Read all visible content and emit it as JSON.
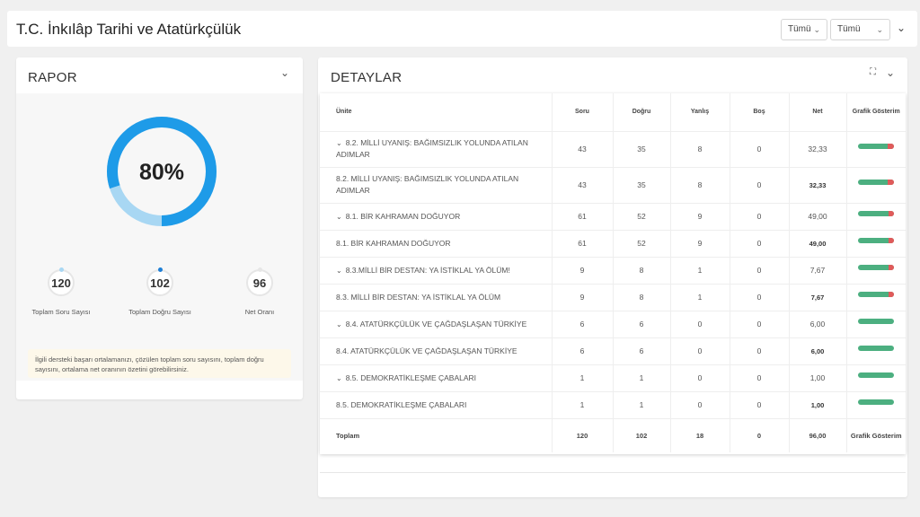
{
  "page_title": "T.C. İnkılâp Tarihi ve Atatürkçülük",
  "filters": [
    {
      "label": "Tümü"
    },
    {
      "label": "Tümü"
    }
  ],
  "colors": {
    "accent": "#1e9be8",
    "accent_light": "#a8d7f3",
    "bar_green": "#4caf80",
    "bar_red": "#e05a5a"
  },
  "rapor": {
    "title": "RAPOR",
    "percent": 80,
    "percent_label": "80%",
    "stats": [
      {
        "value": "120",
        "label": "Toplam Soru Sayısı",
        "dot_color": "#a8d7f3"
      },
      {
        "value": "102",
        "label": "Toplam Doğru Sayısı",
        "dot_color": "#1e7fd6"
      },
      {
        "value": "96",
        "label": "Net Oranı",
        "dot_color": "#e6e6e6"
      }
    ],
    "info": "İlgili dersteki başarı ortalamanızı, çözülen toplam soru sayısını, toplam doğru sayısını, ortalama net oranının özetini görebilirsiniz."
  },
  "detaylar": {
    "title": "DETAYLAR",
    "columns": [
      "Ünite",
      "Soru",
      "Doğru",
      "Yanlış",
      "Boş",
      "Net",
      "Grafik Gösterim"
    ],
    "rows": [
      {
        "unite": "8.2. MİLLİ UYANIŞ: BAĞIMSIZLIK YOLUNDA ATILAN ADIMLAR",
        "group": true,
        "tall": true,
        "soru": "43",
        "dogru": "35",
        "yanlis": "8",
        "bos": "0",
        "net": "32,33",
        "net_bold": false
      },
      {
        "unite": "8.2. MİLLİ UYANIŞ: BAĞIMSIZLIK YOLUNDA ATILAN ADIMLAR",
        "group": false,
        "tall": true,
        "soru": "43",
        "dogru": "35",
        "yanlis": "8",
        "bos": "0",
        "net": "32,33",
        "net_bold": true
      },
      {
        "unite": "8.1. BİR KAHRAMAN DOĞUYOR",
        "group": true,
        "tall": false,
        "soru": "61",
        "dogru": "52",
        "yanlis": "9",
        "bos": "0",
        "net": "49,00",
        "net_bold": false
      },
      {
        "unite": "8.1. BİR KAHRAMAN DOĞUYOR",
        "group": false,
        "tall": false,
        "soru": "61",
        "dogru": "52",
        "yanlis": "9",
        "bos": "0",
        "net": "49,00",
        "net_bold": true
      },
      {
        "unite": "8.3.MİLLİ BİR DESTAN: YA İSTİKLAL YA ÖLÜM!",
        "group": true,
        "tall": false,
        "soru": "9",
        "dogru": "8",
        "yanlis": "1",
        "bos": "0",
        "net": "7,67",
        "net_bold": false
      },
      {
        "unite": "8.3. MİLLİ BİR DESTAN: YA İSTİKLAL YA ÖLÜM",
        "group": false,
        "tall": false,
        "soru": "9",
        "dogru": "8",
        "yanlis": "1",
        "bos": "0",
        "net": "7,67",
        "net_bold": true
      },
      {
        "unite": "8.4. ATATÜRKÇÜLÜK VE ÇAĞDAŞLAŞAN TÜRKİYE",
        "group": true,
        "tall": false,
        "soru": "6",
        "dogru": "6",
        "yanlis": "0",
        "bos": "0",
        "net": "6,00",
        "net_bold": false
      },
      {
        "unite": "8.4. ATATÜRKÇÜLÜK VE ÇAĞDAŞLAŞAN TÜRKİYE",
        "group": false,
        "tall": false,
        "soru": "6",
        "dogru": "6",
        "yanlis": "0",
        "bos": "0",
        "net": "6,00",
        "net_bold": true
      },
      {
        "unite": "8.5. DEMOKRATİKLEŞME ÇABALARI",
        "group": true,
        "tall": false,
        "soru": "1",
        "dogru": "1",
        "yanlis": "0",
        "bos": "0",
        "net": "1,00",
        "net_bold": false
      },
      {
        "unite": "8.5. DEMOKRATİKLEŞME ÇABALARI",
        "group": false,
        "tall": false,
        "soru": "1",
        "dogru": "1",
        "yanlis": "0",
        "bos": "0",
        "net": "1,00",
        "net_bold": true
      }
    ],
    "footer": {
      "label": "Toplam",
      "soru": "120",
      "dogru": "102",
      "yanlis": "18",
      "bos": "0",
      "net": "96,00",
      "grafik": "Grafik Gösterim"
    }
  }
}
